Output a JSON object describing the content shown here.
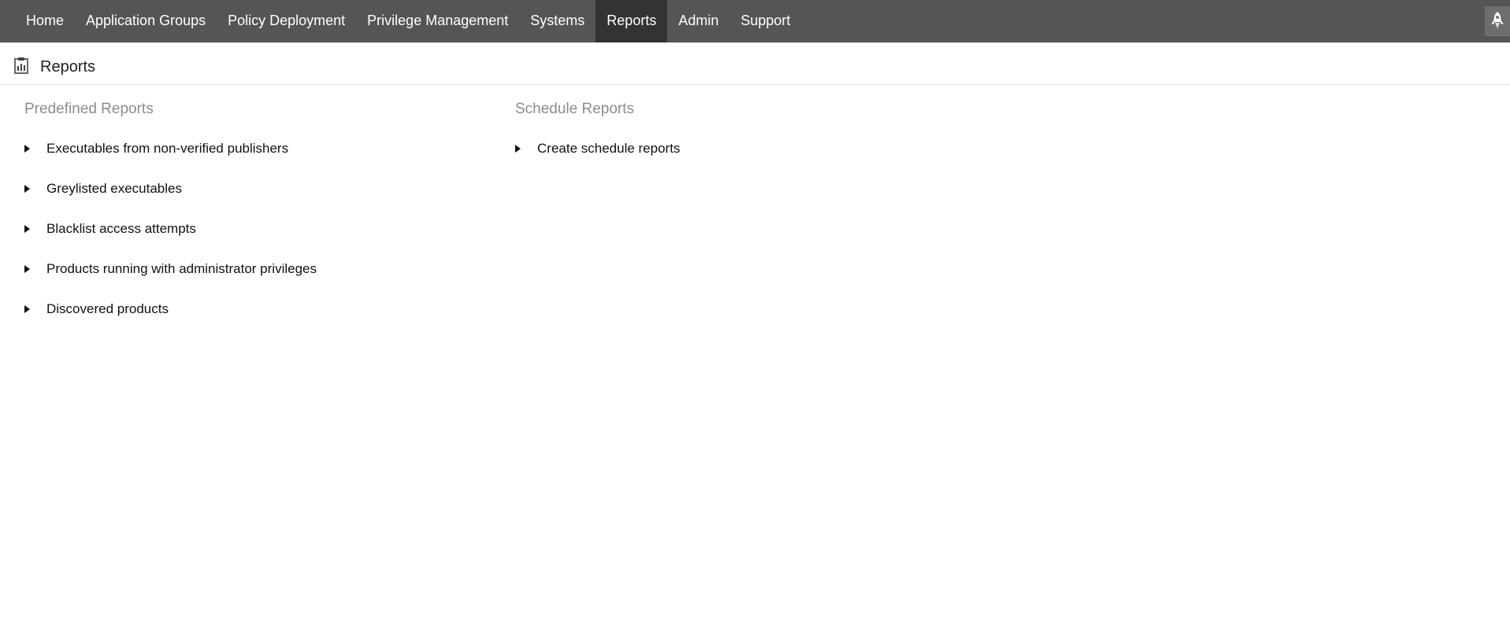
{
  "nav": {
    "items": [
      {
        "label": "Home"
      },
      {
        "label": "Application Groups"
      },
      {
        "label": "Policy Deployment"
      },
      {
        "label": "Privilege Management"
      },
      {
        "label": "Systems"
      },
      {
        "label": "Reports",
        "active": true
      },
      {
        "label": "Admin"
      },
      {
        "label": "Support"
      }
    ],
    "right_icon": "rocket-icon"
  },
  "page": {
    "title": "Reports",
    "icon": "report-icon"
  },
  "predefined": {
    "heading": "Predefined Reports",
    "items": [
      {
        "label": "Executables from non-verified publishers"
      },
      {
        "label": "Greylisted executables"
      },
      {
        "label": "Blacklist access attempts"
      },
      {
        "label": "Products running with administrator privileges"
      },
      {
        "label": "Discovered products"
      }
    ]
  },
  "schedule": {
    "heading": "Schedule Reports",
    "items": [
      {
        "label": "Create schedule reports"
      }
    ]
  },
  "colors": {
    "nav_bg": "#555555",
    "nav_active_bg": "#333333",
    "heading_gray": "#8c8c8c"
  }
}
